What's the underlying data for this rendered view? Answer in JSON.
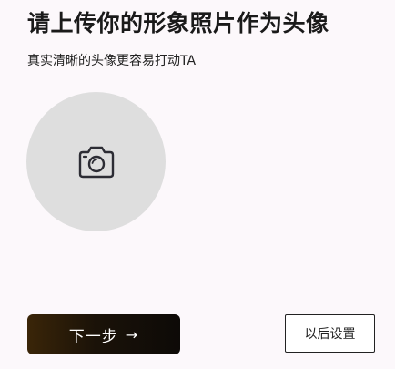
{
  "page": {
    "title": "请上传你的形象照片作为头像",
    "subtitle": "真实清晰的头像更容易打动TA"
  },
  "avatar": {
    "icon": "camera-icon"
  },
  "actions": {
    "next_label": "下一步",
    "next_arrow": "→",
    "later_label": "以后设置"
  },
  "colors": {
    "background": "#fcf8fb",
    "avatar_fill": "#dedede",
    "next_button_dark": "#0d0a07",
    "next_button_brown": "#3a2508",
    "text": "#1a1a1a"
  }
}
